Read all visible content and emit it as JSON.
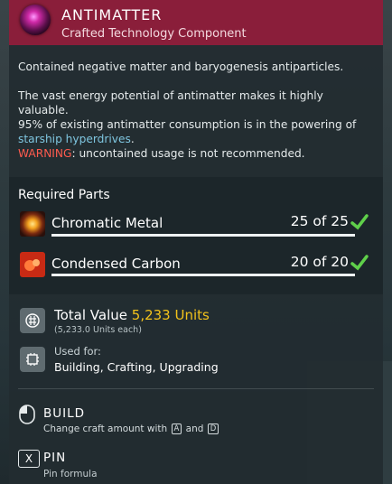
{
  "item": {
    "title": "ANTIMATTER",
    "subtitle": "Crafted Technology Component",
    "icon": "antimatter-orb-icon"
  },
  "description": {
    "line1": "Contained negative matter and baryogenesis antiparticles.",
    "line2_a": "The vast energy potential of antimatter makes it highly valuable.",
    "line2_b": "95% of existing antimatter consumption is in the powering of",
    "line2_highlight": "starship hyperdrives",
    "line2_end": ".",
    "warning_label": "WARNING",
    "warning_text": ": uncontained usage is not recommended."
  },
  "required_parts": {
    "title": "Required Parts",
    "items": [
      {
        "name": "Chromatic Metal",
        "count": "25 of 25",
        "icon": "chromatic-metal-icon",
        "fill": 1.0,
        "status": "satisfied"
      },
      {
        "name": "Condensed Carbon",
        "count": "20 of 20",
        "icon": "condensed-carbon-icon",
        "fill": 1.0,
        "status": "satisfied"
      }
    ]
  },
  "value": {
    "label": "Total Value",
    "amount": "5,233 Units",
    "each": "(5,233.0 Units each)",
    "icon": "units-currency-icon"
  },
  "used_for": {
    "label": "Used for:",
    "list": "Building, Crafting, Upgrading",
    "icon": "chip-icon"
  },
  "actions": {
    "build_label": "BUILD",
    "build_hint_pre": "Change craft amount with",
    "build_key_a": "A",
    "build_hint_and": "and",
    "build_key_d": "D",
    "pin_key": "X",
    "pin_label": "PIN",
    "pin_hint": "Pin formula"
  },
  "colors": {
    "header": "#8a1e3a",
    "accent_value": "#f2c21b",
    "highlight": "#7fc6e0",
    "warning": "#ff5b4e",
    "check": "#5fd04a"
  }
}
